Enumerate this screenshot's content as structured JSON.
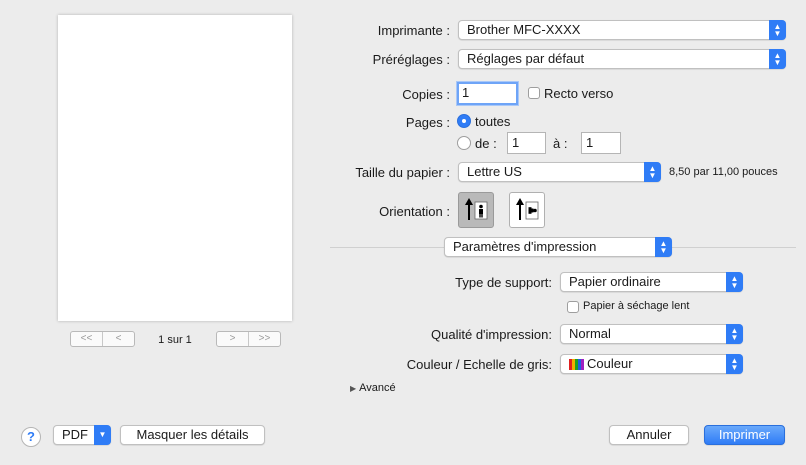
{
  "preview": {
    "first_label": "<<",
    "prev_label": "<",
    "next_label": ">",
    "last_label": ">>",
    "page_count": "1 sur 1"
  },
  "printer": {
    "label": "Imprimante :",
    "value": "Brother MFC-XXXX"
  },
  "presets": {
    "label": "Préréglages :",
    "value": "Réglages par défaut"
  },
  "copies": {
    "label": "Copies :",
    "value": "1",
    "duplex_label": "Recto verso"
  },
  "pages": {
    "label": "Pages :",
    "all_label": "toutes",
    "from_label": "de :",
    "from_value": "1",
    "to_label": "à :",
    "to_value": "1"
  },
  "paper_size": {
    "label": "Taille du papier :",
    "value": "Lettre US",
    "dimensions": "8,50 par 11,00 pouces"
  },
  "orientation": {
    "label": "Orientation :"
  },
  "section": {
    "value": "Paramètres d'impression"
  },
  "media_type": {
    "label": "Type de support:",
    "value": "Papier ordinaire",
    "slow_dry_label": "Papier à séchage lent"
  },
  "print_quality": {
    "label": "Qualité d'impression:",
    "value": "Normal"
  },
  "color_mode": {
    "label": "Couleur / Echelle de gris:",
    "value": "Couleur"
  },
  "advanced": {
    "label": "Avancé"
  },
  "footer": {
    "help_label": "?",
    "pdf_label": "PDF",
    "hide_details_label": "Masquer les détails",
    "cancel_label": "Annuler",
    "print_label": "Imprimer"
  },
  "colors": {
    "accent": "#2f7cf6"
  }
}
